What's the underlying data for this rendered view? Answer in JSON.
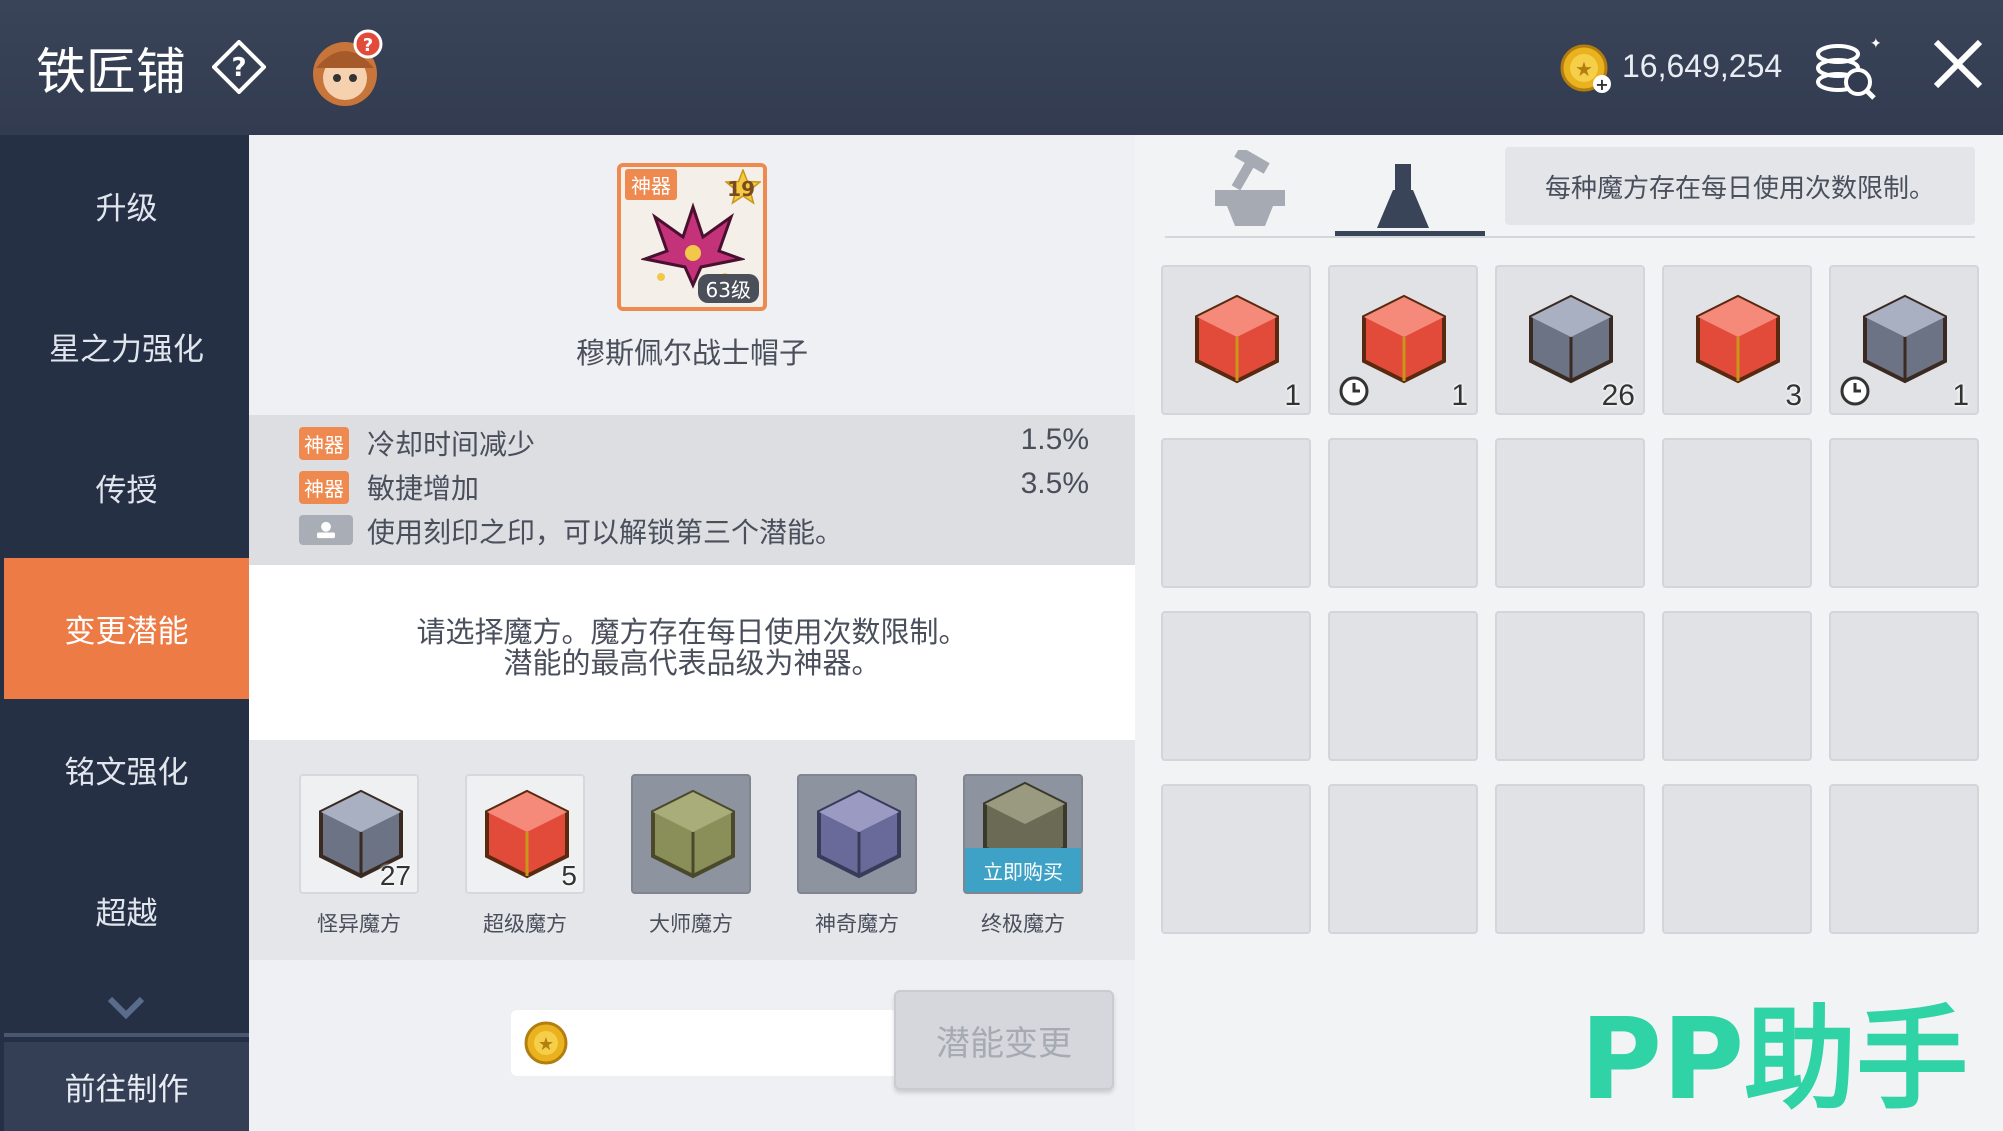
{
  "header": {
    "title": "铁匠铺",
    "money": "16,649,254"
  },
  "sidebar": {
    "items": [
      {
        "label": "升级"
      },
      {
        "label": "星之力强化"
      },
      {
        "label": "传授"
      },
      {
        "label": "变更潜能",
        "active": true
      },
      {
        "label": "铭文强化"
      },
      {
        "label": "超越"
      }
    ],
    "bottom_button": "前往制作"
  },
  "item": {
    "grade": "神器",
    "stars": "19",
    "level": "63级",
    "name": "穆斯佩尔战士帽子"
  },
  "stats": [
    {
      "tag": "神器",
      "label": "冷却时间减少",
      "value": "1.5%"
    },
    {
      "tag": "神器",
      "label": "敏捷增加",
      "value": "3.5%"
    },
    {
      "tag": "",
      "label": "使用刻印之印，可以解锁第三个潜能。",
      "value": ""
    }
  ],
  "notice": {
    "line1": "请选择魔方。魔方存在每日使用次数限制。",
    "line2": "潜能的最高代表品级为神器。"
  },
  "cubes": [
    {
      "name": "怪异魔方",
      "count": "27",
      "color": "#6b7385"
    },
    {
      "name": "超级魔方",
      "count": "5",
      "color": "#e24a3a"
    },
    {
      "name": "大师魔方",
      "count": "",
      "color": "#8a8f5a"
    },
    {
      "name": "神奇魔方",
      "count": "",
      "color": "#6a6a9a"
    },
    {
      "name": "终极魔方",
      "count": "",
      "color": "#6b6b55",
      "buy_label": "立即购买"
    }
  ],
  "actions": {
    "change_label": "潜能变更"
  },
  "right_panel": {
    "tabs": [
      {
        "icon": "anvil-icon"
      },
      {
        "icon": "flask-icon",
        "active": true
      }
    ],
    "notice": "每种魔方存在每日使用次数限制。",
    "inventory": [
      {
        "count": "1",
        "color": "#e24a3a",
        "timed": false
      },
      {
        "count": "1",
        "color": "#e24a3a",
        "timed": true
      },
      {
        "count": "26",
        "color": "#6b7385",
        "timed": false
      },
      {
        "count": "3",
        "color": "#e24a3a",
        "timed": false
      },
      {
        "count": "1",
        "color": "#6b7385",
        "timed": true
      }
    ],
    "empty_slots": 15
  },
  "watermark": "PP助手",
  "colors": {
    "accent": "#ed7b45",
    "header": "#3a4459",
    "sidebar": "#263044",
    "watermark": "#2fd3a5"
  }
}
